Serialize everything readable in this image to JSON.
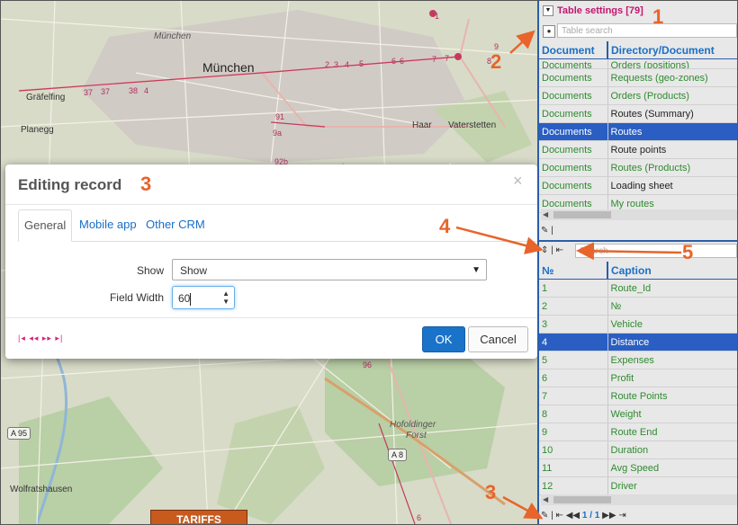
{
  "map": {
    "labels": {
      "munchen_big": "München",
      "munchen_small": "München",
      "grafelfing": "Gräfelfing",
      "planegg": "Planegg",
      "haar": "Haar",
      "vaterstetten": "Vaterstetten",
      "hofoldinger": "Hofoldinger",
      "forst": "Forst",
      "wolfratshausen": "Wolfratshausen",
      "a95": "A 95",
      "a8": "A 8"
    },
    "road_numbers": {
      "r1": "37",
      "r2": "37",
      "r3": "38",
      "r4": "4",
      "r5": "2",
      "r6": "3",
      "r7": "4",
      "r8": "5",
      "r9": "6",
      "r10": "6",
      "r11": "7",
      "r12": "7",
      "r13": "9",
      "r14": "8",
      "r15": "91",
      "r16": "9a",
      "r17": "92b",
      "r18": "96",
      "r19": "1",
      "r20": "6"
    },
    "tariffs_label": "TARIFFS"
  },
  "modal": {
    "title": "Editing record",
    "close": "×",
    "tabs": [
      "General",
      "Mobile app",
      "Other CRM"
    ],
    "show_label": "Show",
    "show_value": "Show",
    "field_width_label": "Field Width",
    "field_width_value": "60",
    "pager": "|◂ ◂◂ ▸▸ ▸|",
    "ok_label": "OK",
    "cancel_label": "Cancel"
  },
  "panel": {
    "title": "Table settings [79]",
    "search_placeholder": "Table search",
    "table1": {
      "headers": [
        "Document",
        "Directory/Document"
      ],
      "rows": [
        {
          "c1": "Documents",
          "c2": "Orders (positions)",
          "selected": false
        },
        {
          "c1": "Documents",
          "c2": "Requests (geo-zones)",
          "selected": false
        },
        {
          "c1": "Documents",
          "c2": "Orders (Products)",
          "selected": false
        },
        {
          "c1": "Documents",
          "c2": "Routes (Summary)",
          "selected": false
        },
        {
          "c1": "Documents",
          "c2": "Routes",
          "selected": true
        },
        {
          "c1": "Documents",
          "c2": "Route points",
          "selected": false
        },
        {
          "c1": "Documents",
          "c2": "Routes (Products)",
          "selected": false
        },
        {
          "c1": "Documents",
          "c2": "Loading sheet",
          "selected": false
        },
        {
          "c1": "Documents",
          "c2": "My routes",
          "selected": false
        }
      ]
    },
    "search2_placeholder": "Search",
    "table2": {
      "headers": [
        "№",
        "Caption"
      ],
      "rows": [
        {
          "c1": "1",
          "c2": "Route_Id"
        },
        {
          "c1": "2",
          "c2": "№"
        },
        {
          "c1": "3",
          "c2": "Vehicle"
        },
        {
          "c1": "4",
          "c2": "Distance",
          "selected": true
        },
        {
          "c1": "5",
          "c2": "Expenses"
        },
        {
          "c1": "6",
          "c2": "Profit"
        },
        {
          "c1": "7",
          "c2": "Route Points"
        },
        {
          "c1": "8",
          "c2": "Weight"
        },
        {
          "c1": "9",
          "c2": "Route End"
        },
        {
          "c1": "10",
          "c2": "Duration"
        },
        {
          "c1": "11",
          "c2": "Avg Speed"
        },
        {
          "c1": "12",
          "c2": "Driver"
        }
      ]
    },
    "page_indicator": "1 / 1"
  },
  "annotations": {
    "n1": "1",
    "n2": "2",
    "n3_modal": "3",
    "n3_bottom": "3",
    "n4": "4",
    "n5": "5"
  },
  "colors": {
    "accent_blue": "#2a5ec2",
    "title_magenta": "#c2166f",
    "annotation_orange": "#e8642a",
    "ok_button": "#1a73c9"
  }
}
